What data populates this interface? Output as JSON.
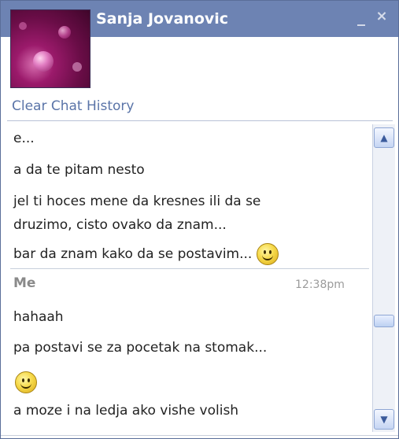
{
  "header": {
    "contact_name": "Sanja Jovanovic",
    "minimize_label": "_",
    "close_label": "×"
  },
  "actions": {
    "clear_history": "Clear Chat History"
  },
  "messages_contact": [
    "e...",
    "a da te pitam nesto",
    "jel ti hoces mene da kresnes ili da se",
    "druzimo, cisto ovako da znam...",
    "bar da znam kako da se postavim..."
  ],
  "me_group": {
    "sender": "Me",
    "time": "12:38pm",
    "messages": [
      "hahaah",
      "pa postavi se za pocetak na stomak...",
      "a moze i na ledja ako vishe volish"
    ]
  },
  "scroll": {
    "up_icon": "chevron-up-icon",
    "down_icon": "chevron-down-icon",
    "up": "▲",
    "down": "▼"
  },
  "colors": {
    "header_bg": "#6d83b3",
    "link": "#5a74a8"
  }
}
